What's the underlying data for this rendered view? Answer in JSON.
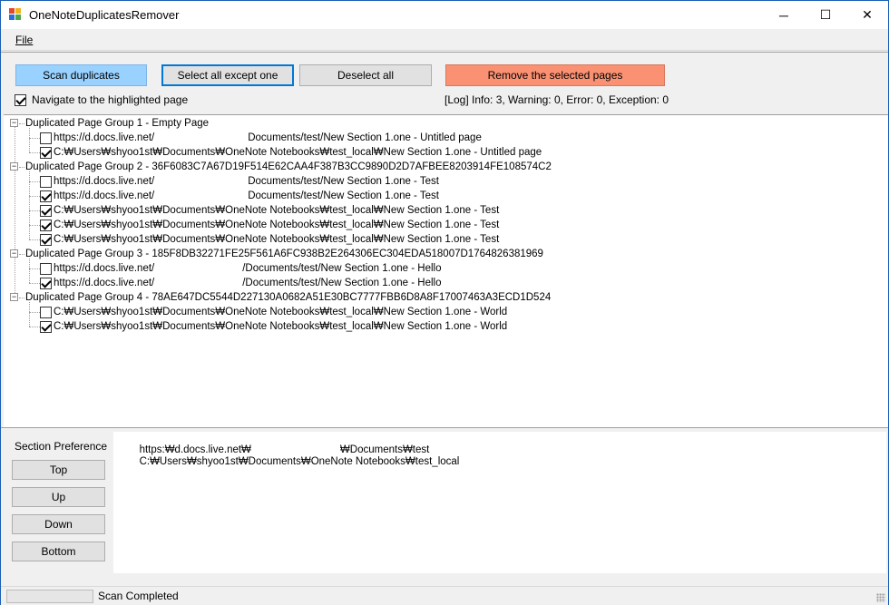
{
  "window": {
    "title": "OneNoteDuplicatesRemover",
    "minimize": "─",
    "maximize": "☐",
    "close": "✕"
  },
  "menu": {
    "file_label": "File"
  },
  "toolbar": {
    "scan_label": "Scan duplicates",
    "select_all_except_one_label": "Select all except one",
    "deselect_all_label": "Deselect all",
    "remove_label": "Remove the selected pages",
    "navigate_label": "Navigate to the highlighted page",
    "navigate_checked": true,
    "log_status": "[Log] Info: 3, Warning: 0, Error: 0, Exception: 0"
  },
  "colors": {
    "scan_btn": "#99d1ff",
    "remove_btn": "#fa9173",
    "titlebar_border": "#1b5fb5"
  },
  "groups": [
    {
      "label": "Duplicated Page Group 1 - Empty Page",
      "items": [
        {
          "checked": false,
          "left": "https://d.docs.live.net/",
          "right": "Documents/test/New Section 1.one - Untitled page"
        },
        {
          "checked": true,
          "left": "C:₩Users₩shyoo1st₩Documents₩OneNote Notebooks₩test_local₩New Section 1.one - Untitled page",
          "right": ""
        }
      ]
    },
    {
      "label": "Duplicated Page Group 2 - 36F6083C7A67D19F514E62CAA4F387B3CC9890D2D7AFBEE8203914FE108574C2",
      "items": [
        {
          "checked": false,
          "left": "https://d.docs.live.net/",
          "right": "Documents/test/New Section 1.one - Test"
        },
        {
          "checked": true,
          "left": "https://d.docs.live.net/",
          "right": "Documents/test/New Section 1.one - Test"
        },
        {
          "checked": true,
          "left": "C:₩Users₩shyoo1st₩Documents₩OneNote Notebooks₩test_local₩New Section 1.one - Test",
          "right": ""
        },
        {
          "checked": true,
          "left": "C:₩Users₩shyoo1st₩Documents₩OneNote Notebooks₩test_local₩New Section 1.one - Test",
          "right": ""
        },
        {
          "checked": true,
          "left": "C:₩Users₩shyoo1st₩Documents₩OneNote Notebooks₩test_local₩New Section 1.one - Test",
          "right": ""
        }
      ]
    },
    {
      "label": "Duplicated Page Group 3 - 185F8DB32271FE25F561A6FC938B2E264306EC304EDA518007D1764826381969",
      "items": [
        {
          "checked": false,
          "left": "https://d.docs.live.net/",
          "right": "/Documents/test/New Section 1.one - Hello"
        },
        {
          "checked": true,
          "left": "https://d.docs.live.net/",
          "right": "/Documents/test/New Section 1.one - Hello"
        }
      ]
    },
    {
      "label": "Duplicated Page Group 4 - 78AE647DC5544D227130A0682A51E30BC7777FBB6D8A8F17007463A3ECD1D524",
      "items": [
        {
          "checked": false,
          "left": "C:₩Users₩shyoo1st₩Documents₩OneNote Notebooks₩test_local₩New Section 1.one - World",
          "right": ""
        },
        {
          "checked": true,
          "left": "C:₩Users₩shyoo1st₩Documents₩OneNote Notebooks₩test_local₩New Section 1.one - World",
          "right": ""
        }
      ]
    }
  ],
  "section_preference": {
    "label": "Section Preference",
    "buttons": {
      "top": "Top",
      "up": "Up",
      "down": "Down",
      "bottom": "Bottom"
    },
    "entries": [
      {
        "left": "https:₩d.docs.live.net₩",
        "right": "₩Documents₩test"
      },
      {
        "left": "C:₩Users₩shyoo1st₩Documents₩OneNote Notebooks₩test_local",
        "right": ""
      }
    ]
  },
  "status": {
    "text": "Scan Completed"
  }
}
